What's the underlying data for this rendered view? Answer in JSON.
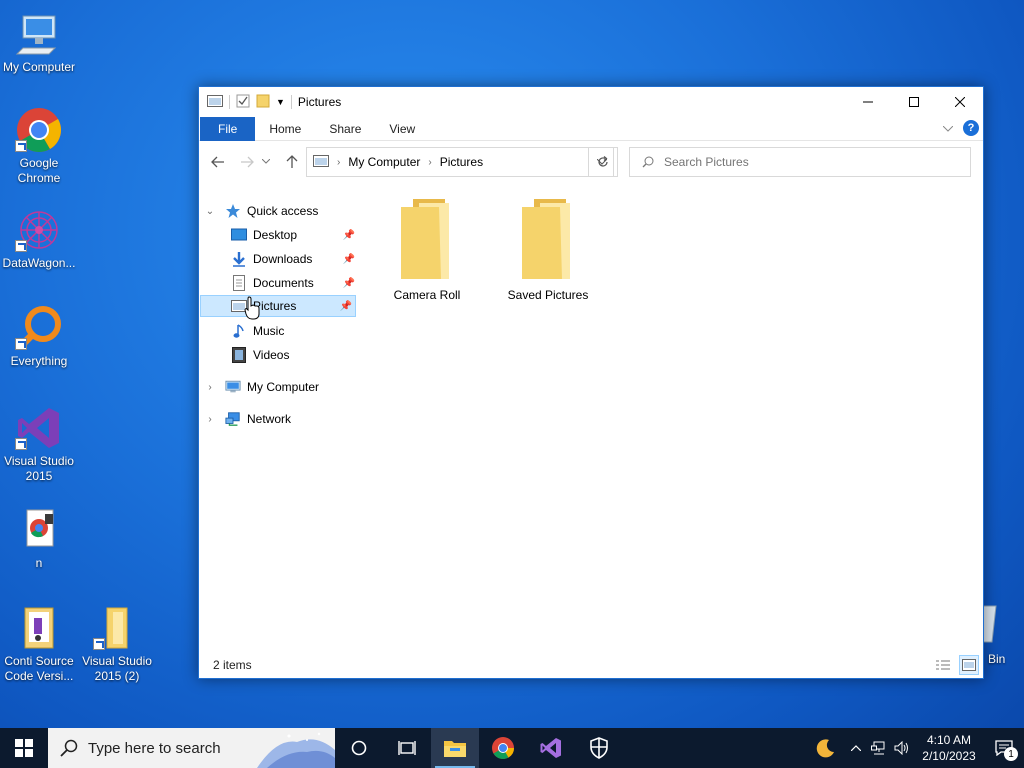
{
  "desktop": {
    "icons": [
      {
        "label": "My Computer"
      },
      {
        "label": "Google Chrome"
      },
      {
        "label": "DataWagon..."
      },
      {
        "label": "Everything"
      },
      {
        "label": "Visual Studio 2015"
      },
      {
        "label": "n"
      },
      {
        "label": "Conti Source Code Versi..."
      },
      {
        "label": "Visual Studio 2015 (2)"
      }
    ],
    "recycle_bin_partial": "Bin"
  },
  "window": {
    "title": "Pictures",
    "ribbon_tabs": [
      "File",
      "Home",
      "Share",
      "View"
    ],
    "help_glyph": "?",
    "address": {
      "crumbs": [
        "My Computer",
        "Pictures"
      ]
    },
    "search_placeholder": "Search Pictures",
    "nav": {
      "quick_access": "Quick access",
      "quick_items": [
        "Desktop",
        "Downloads",
        "Documents",
        "Pictures",
        "Music",
        "Videos"
      ],
      "my_computer": "My Computer",
      "network": "Network"
    },
    "items": [
      {
        "name": "Camera Roll"
      },
      {
        "name": "Saved Pictures"
      }
    ],
    "status": "2 items"
  },
  "taskbar": {
    "search_placeholder": "Type here to search",
    "time": "4:10 AM",
    "date": "2/10/2023",
    "notification_count": "1"
  },
  "colors": {
    "accent": "#1a64c5",
    "selection": "#cce8ff",
    "folder": "#f5d36b",
    "taskbar": "#0c1a2e"
  }
}
